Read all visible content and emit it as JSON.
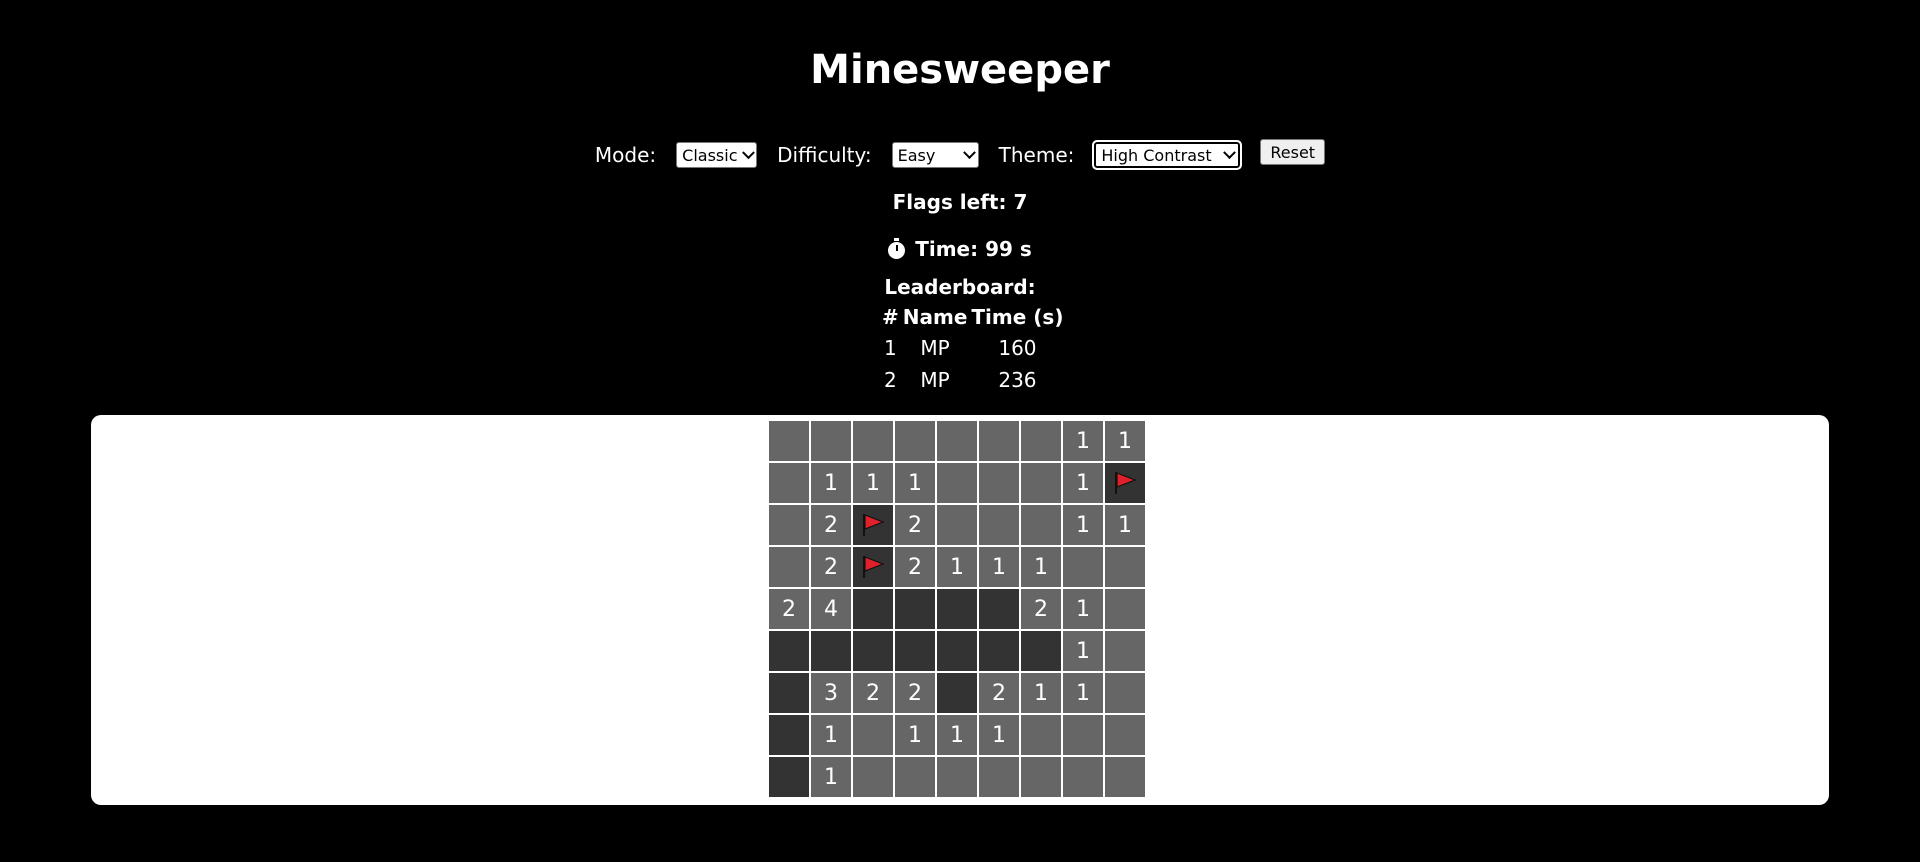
{
  "title": "Minesweeper",
  "controls": {
    "mode_label": "Mode:",
    "mode_value": "Classic",
    "difficulty_label": "Difficulty:",
    "difficulty_value": "Easy",
    "theme_label": "Theme:",
    "theme_value": "High Contrast",
    "reset_label": "Reset"
  },
  "status": {
    "flags_left": "Flags left: 7",
    "time": "Time: 99 s"
  },
  "leaderboard": {
    "title": "Leaderboard:",
    "headers": [
      "#",
      "Name",
      "Time (s)"
    ],
    "rows": [
      [
        "1",
        "MP",
        "160"
      ],
      [
        "2",
        "MP",
        "236"
      ]
    ]
  },
  "colors": {
    "background": "#000000",
    "board_panel": "#ffffff",
    "revealed_cell": "#666666",
    "hidden_cell": "#333333",
    "flag": "#e0202a"
  },
  "board": {
    "rows": 9,
    "cols": 9,
    "cells": [
      [
        "",
        "",
        "",
        "",
        "",
        "",
        "",
        "1",
        "1"
      ],
      [
        "",
        "1",
        "1",
        "1",
        "",
        "",
        "",
        "1",
        "F"
      ],
      [
        "",
        "2",
        "F",
        "2",
        "",
        "",
        "",
        "1",
        "1"
      ],
      [
        "",
        "2",
        "F",
        "2",
        "1",
        "1",
        "1",
        "",
        ""
      ],
      [
        "2",
        "4",
        "H",
        "H",
        "H",
        "H",
        "2",
        "1",
        ""
      ],
      [
        "H",
        "H",
        "H",
        "H",
        "H",
        "H",
        "H",
        "1",
        ""
      ],
      [
        "H",
        "3",
        "2",
        "2",
        "H",
        "2",
        "1",
        "1",
        ""
      ],
      [
        "H",
        "1",
        "",
        "1",
        "1",
        "1",
        "",
        "",
        ""
      ],
      [
        "H",
        "1",
        "",
        "",
        "",
        "",
        "",
        "",
        ""
      ]
    ]
  }
}
